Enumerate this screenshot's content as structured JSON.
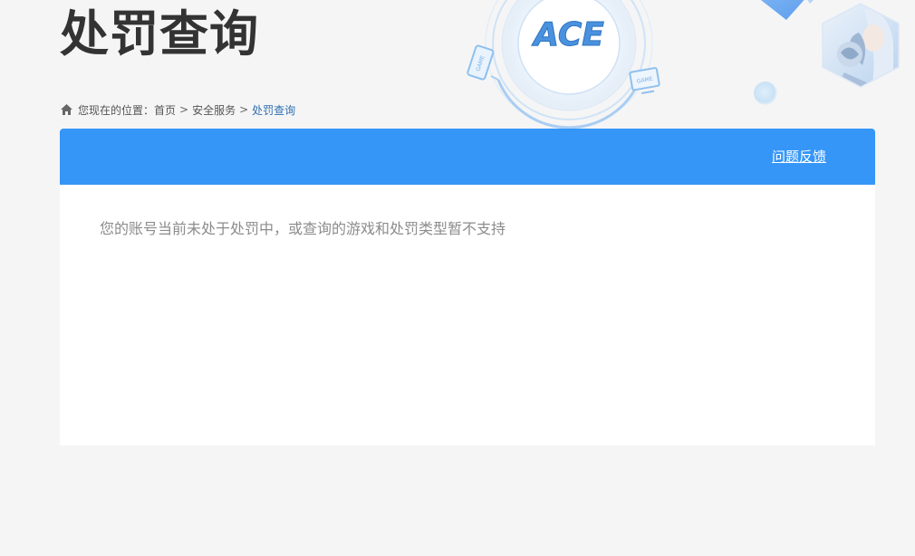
{
  "header": {
    "title": "处罚查询",
    "logo_text": "ACE",
    "device_badge_1": "GAME",
    "device_badge_2": "GAME"
  },
  "breadcrumb": {
    "prefix": "您现在的位置：",
    "items": [
      {
        "label": "首页"
      },
      {
        "label": "安全服务"
      },
      {
        "label": "处罚查询"
      }
    ],
    "separator": ">"
  },
  "panel": {
    "feedback_label": "问题反馈",
    "message": "您的账号当前未处于处罚中，或查询的游戏和处罚类型暂不支持"
  },
  "colors": {
    "accent": "#3596f7",
    "background": "#f5f5f5",
    "title": "#333333",
    "message": "#8c8c8c",
    "breadcrumb_current": "#2f6fb0"
  },
  "icons": {
    "home": "home-icon"
  }
}
